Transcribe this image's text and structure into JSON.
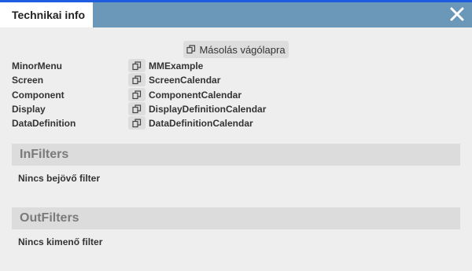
{
  "dialog": {
    "title": "Technikai info"
  },
  "copy_all": {
    "label": "Másolás vágólapra"
  },
  "info_rows": [
    {
      "key": "MinorMenu",
      "value": "MMExample"
    },
    {
      "key": "Screen",
      "value": "ScreenCalendar"
    },
    {
      "key": "Component",
      "value": "ComponentCalendar"
    },
    {
      "key": "Display",
      "value": "DisplayDefinitionCalendar"
    },
    {
      "key": "DataDefinition",
      "value": "DataDefinitionCalendar"
    }
  ],
  "in_filters": {
    "heading": "InFilters",
    "empty_text": "Nincs bejövő filter"
  },
  "out_filters": {
    "heading": "OutFilters",
    "empty_text": "Nincs kimenő filter"
  },
  "colors": {
    "titlebar": "#6b97b9",
    "titlebar_border": "#1e5de0",
    "background": "#eeeeee",
    "section_header": "#dcdcdc"
  },
  "icons": {
    "close": "close-icon",
    "copy": "copy-icon"
  }
}
